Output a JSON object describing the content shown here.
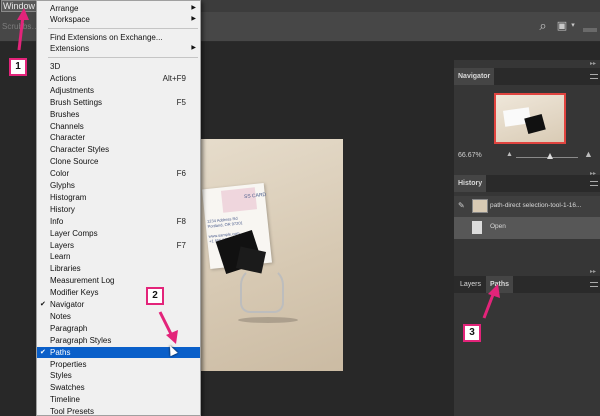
{
  "menubar": {
    "window_label": "Window"
  },
  "optionsbar": {
    "hint": "Scrubbs…"
  },
  "menu": {
    "items_top": [
      {
        "label": "Arrange",
        "submenu": true
      },
      {
        "label": "Workspace",
        "submenu": true
      }
    ],
    "items_ext": [
      {
        "label": "Find Extensions on Exchange..."
      },
      {
        "label": "Extensions",
        "submenu": true
      }
    ],
    "items": [
      {
        "label": "3D",
        "shortcut": ""
      },
      {
        "label": "Actions",
        "shortcut": "Alt+F9"
      },
      {
        "label": "Adjustments",
        "shortcut": ""
      },
      {
        "label": "Brush Settings",
        "shortcut": "F5"
      },
      {
        "label": "Brushes",
        "shortcut": ""
      },
      {
        "label": "Channels",
        "shortcut": ""
      },
      {
        "label": "Character",
        "shortcut": ""
      },
      {
        "label": "Character Styles",
        "shortcut": ""
      },
      {
        "label": "Clone Source",
        "shortcut": ""
      },
      {
        "label": "Color",
        "shortcut": "F6"
      },
      {
        "label": "Glyphs",
        "shortcut": ""
      },
      {
        "label": "Histogram",
        "shortcut": ""
      },
      {
        "label": "History",
        "shortcut": ""
      },
      {
        "label": "Info",
        "shortcut": "F8"
      },
      {
        "label": "Layer Comps",
        "shortcut": ""
      },
      {
        "label": "Layers",
        "shortcut": "F7"
      },
      {
        "label": "Learn",
        "shortcut": ""
      },
      {
        "label": "Libraries",
        "shortcut": ""
      },
      {
        "label": "Measurement Log",
        "shortcut": ""
      },
      {
        "label": "Modifier Keys",
        "shortcut": ""
      },
      {
        "label": "Navigator",
        "shortcut": "",
        "checked": true
      },
      {
        "label": "Notes",
        "shortcut": ""
      },
      {
        "label": "Paragraph",
        "shortcut": ""
      },
      {
        "label": "Paragraph Styles",
        "shortcut": ""
      },
      {
        "label": "Paths",
        "shortcut": "",
        "checked": true,
        "selected": true
      },
      {
        "label": "Properties",
        "shortcut": ""
      },
      {
        "label": "Styles",
        "shortcut": ""
      },
      {
        "label": "Swatches",
        "shortcut": ""
      },
      {
        "label": "Timeline",
        "shortcut": ""
      },
      {
        "label": "Tool Presets",
        "shortcut": ""
      }
    ],
    "check_glyph": "✔"
  },
  "navigator": {
    "title": "Navigator",
    "zoom": "66.67%"
  },
  "history": {
    "title": "History",
    "rows": [
      {
        "label": "path-direct selection-tool-1-16...",
        "icon": "brush-icon"
      },
      {
        "label": "Open",
        "icon": "document-icon"
      }
    ]
  },
  "layers_panel": {
    "tab_layers": "Layers",
    "tab_paths": "Paths"
  },
  "card": {
    "name": "SS CARD",
    "lines": "1234 Address Rd\nPortland, OR 97201\n\nwww.sample.com\n+1 555 555 5555"
  },
  "annotations": {
    "step1": "1",
    "step2": "2",
    "step3": "3",
    "accent": "#e3247a"
  }
}
